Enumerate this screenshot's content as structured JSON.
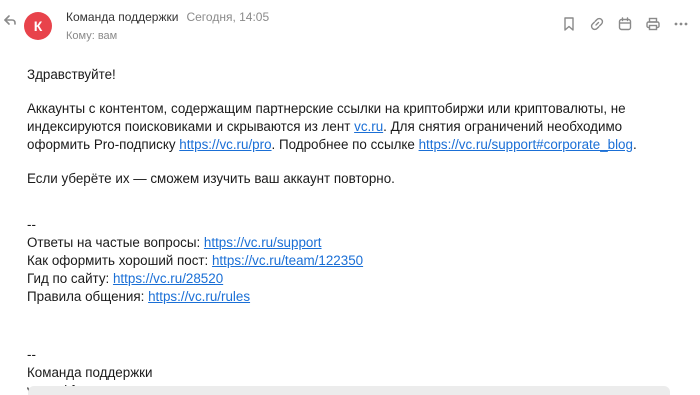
{
  "colors": {
    "avatar_bg": "#e8434b",
    "link": "#1a6fd6",
    "muted": "#8a8a8a"
  },
  "header": {
    "avatar_letter": "К",
    "sender": "Команда поддержки",
    "date": "Сегодня, 14:05",
    "to": "Кому: вам"
  },
  "toolbar": {
    "icons": [
      "bookmark-icon",
      "link-icon",
      "calendar-icon",
      "print-icon",
      "more-icon"
    ]
  },
  "body": {
    "greeting": "Здравствуйте!",
    "p1_a": "Аккаунты с контентом, содержащим партнерские ссылки на криптобиржи или криптовалюты, не индексируются поисковиками и скрываются из лент ",
    "p1_link1": "vc.ru",
    "p1_b": ". Для снятия ограничений необходимо оформить Pro-подписку ",
    "p1_link2": "https://vc.ru/pro",
    "p1_c": ". Подробнее по ссылке ",
    "p1_link3": "https://vc.ru/support#corporate_blog",
    "p1_d": ".",
    "p2": "Если уберёте их — сможем изучить ваш аккаунт повторно.",
    "sep1": "--",
    "faq_label": "Ответы на частые вопросы: ",
    "faq_link": "https://vc.ru/support",
    "post_label": "Как оформить хороший пост: ",
    "post_link": "https://vc.ru/team/122350",
    "guide_label": "Гид по сайту: ",
    "guide_link": "https://vc.ru/28520",
    "rules_label": "Правила общения: ",
    "rules_link": "https://vc.ru/rules",
    "sep2": "--",
    "sig_team": "Команда поддержки",
    "sig_sites": "vc.ru dtf.ru"
  }
}
